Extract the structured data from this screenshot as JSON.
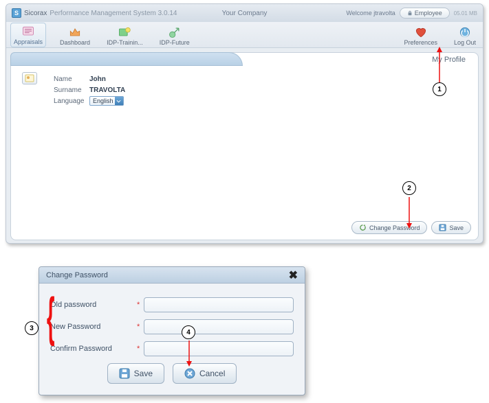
{
  "titlebar": {
    "brand": "Sicorax",
    "subtitle": "Performance Management System 3.0.14",
    "company": "Your Company",
    "welcome": "Welcome jtravolta",
    "employee_btn": "Employee",
    "memory": "05.01 MB"
  },
  "toolbar": {
    "appraisals": "Appraisals",
    "dashboard": "Dashboard",
    "idp_training": "IDP-Trainin...",
    "idp_future": "IDP-Future",
    "preferences": "Preferences",
    "logout": "Log Out"
  },
  "profile": {
    "heading": "My Profile",
    "name_label": "Name",
    "name_value": "John",
    "surname_label": "Surname",
    "surname_value": "TRAVOLTA",
    "language_label": "Language",
    "language_value": "English"
  },
  "footer": {
    "change_password": "Change Password",
    "save": "Save"
  },
  "dialog": {
    "title": "Change Password",
    "old_pw": "Old password",
    "new_pw": "New Password",
    "confirm_pw": "Confirm Password",
    "save": "Save",
    "cancel": "Cancel"
  },
  "annotations": {
    "n1": "1",
    "n2": "2",
    "n3": "3",
    "n4": "4"
  }
}
